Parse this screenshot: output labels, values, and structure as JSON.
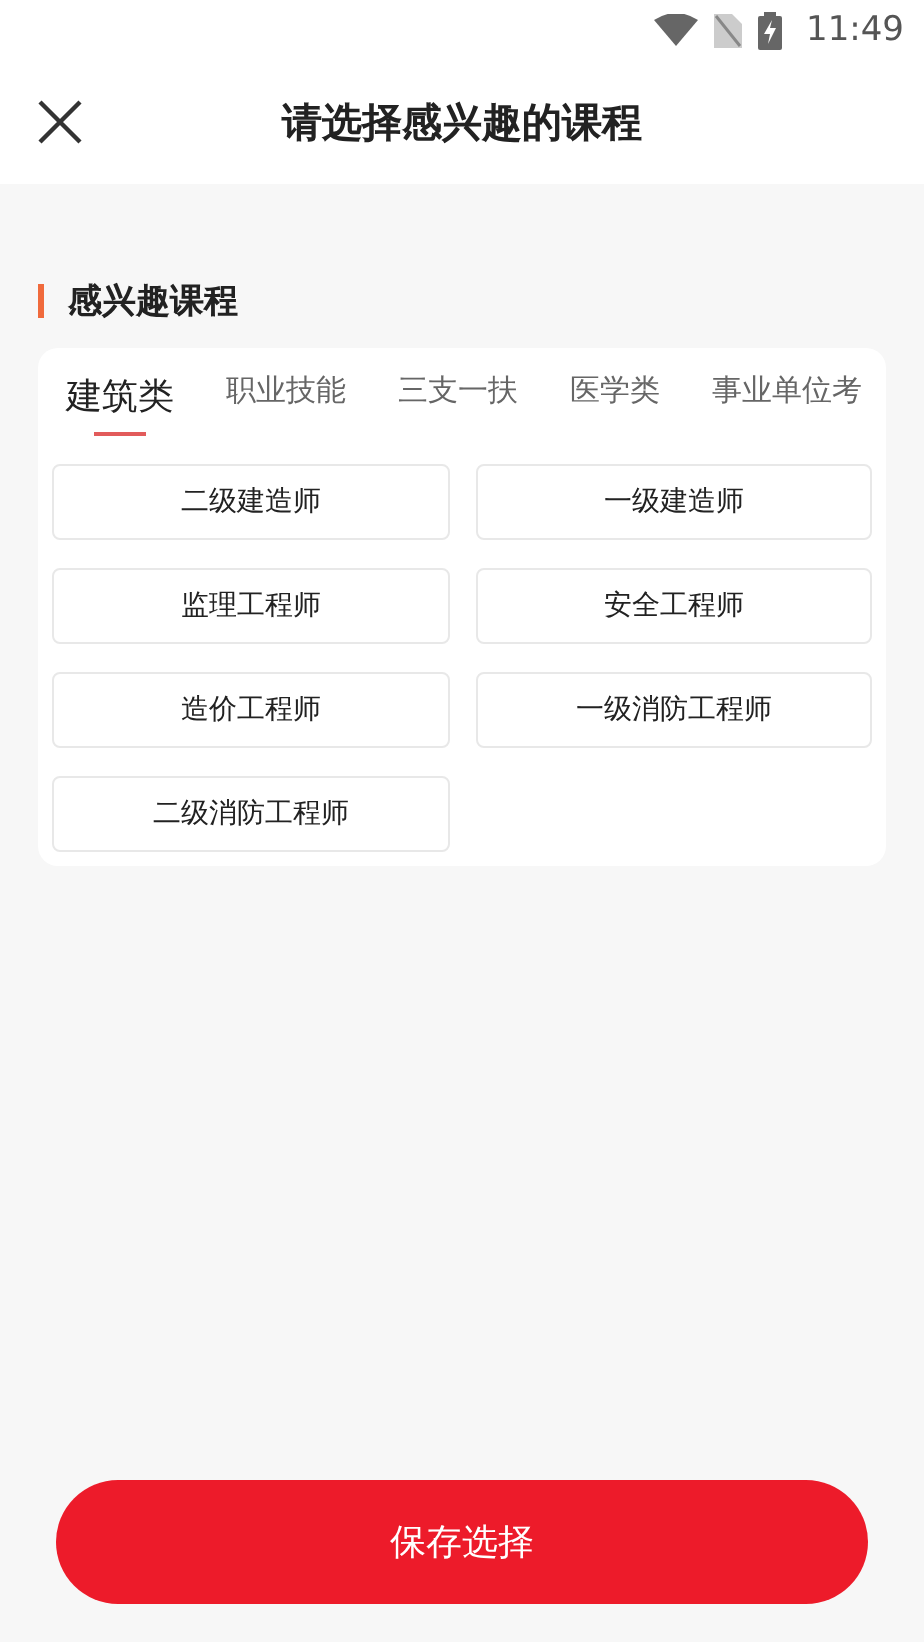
{
  "status_bar": {
    "time": "11:49"
  },
  "header": {
    "title": "请选择感兴趣的课程"
  },
  "section": {
    "title": "感兴趣课程"
  },
  "tabs": [
    {
      "label": "建筑类",
      "selected": true
    },
    {
      "label": "职业技能",
      "selected": false
    },
    {
      "label": "三支一扶",
      "selected": false
    },
    {
      "label": "医学类",
      "selected": false
    },
    {
      "label": "事业单位考",
      "selected": false
    }
  ],
  "courses": [
    {
      "label": "二级建造师"
    },
    {
      "label": "一级建造师"
    },
    {
      "label": "监理工程师"
    },
    {
      "label": "安全工程师"
    },
    {
      "label": "造价工程师"
    },
    {
      "label": "一级消防工程师"
    },
    {
      "label": "二级消防工程师"
    }
  ],
  "save_button": {
    "label": "保存选择"
  }
}
